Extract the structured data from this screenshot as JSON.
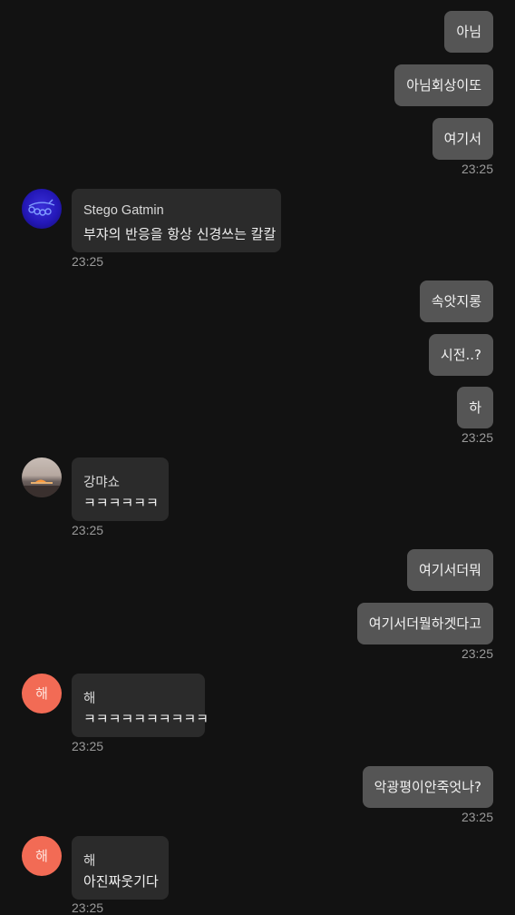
{
  "messages": [
    {
      "dir": "out",
      "text": "아님"
    },
    {
      "dir": "out",
      "text": "아님회상이또"
    },
    {
      "dir": "out",
      "text": "여기서",
      "time": "23:25"
    },
    {
      "dir": "in",
      "sender": "Stego Gatmin",
      "text": "부쟈의 반응을 항상 신경쓰는 칼칼",
      "time": "23:25"
    },
    {
      "dir": "out",
      "text": "속앗지롱"
    },
    {
      "dir": "out",
      "text": "시전..?"
    },
    {
      "dir": "out",
      "text": "하",
      "time": "23:25"
    },
    {
      "dir": "in",
      "sender": "강먀쇼",
      "text": "ㅋㅋㅋㅋㅋㅋ",
      "time": "23:25"
    },
    {
      "dir": "out",
      "text": "여기서더뭐"
    },
    {
      "dir": "out",
      "text": "여기서더뭘하겟다고",
      "time": "23:25"
    },
    {
      "dir": "in",
      "sender": "해",
      "avatar_letter": "해",
      "text": "ㅋㅋㅋㅋㅋㅋㅋㅋㅋㅋ",
      "time": "23:25"
    },
    {
      "dir": "out",
      "text": "악광평이안죽엇나?",
      "time": "23:25"
    },
    {
      "dir": "in",
      "sender": "해",
      "avatar_letter": "해",
      "text": "아진짜웃기다",
      "time": "23:25"
    }
  ],
  "colors": {
    "background": "#121212",
    "outgoing_bubble": "#555555",
    "incoming_bubble": "#2b2b2b",
    "timestamp": "#9a9a9a",
    "letter_avatar": "#f26b55"
  }
}
